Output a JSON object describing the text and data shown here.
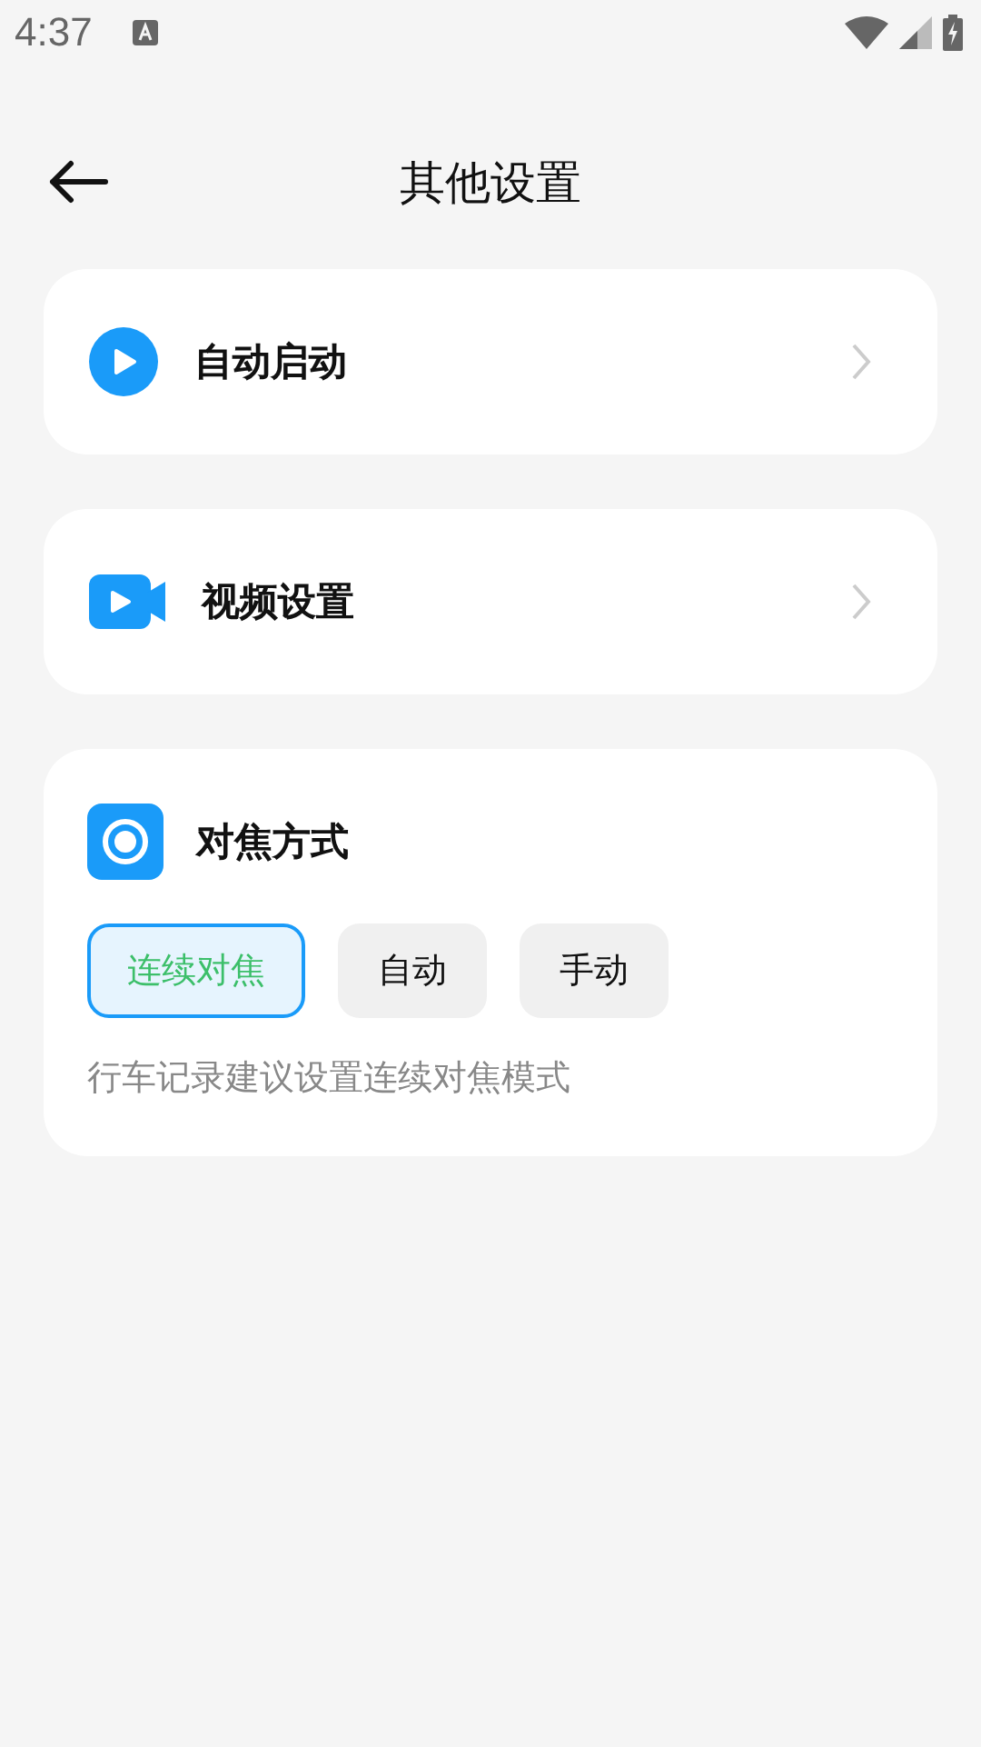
{
  "status_bar": {
    "time": "4:37"
  },
  "header": {
    "title": "其他设置"
  },
  "settings": [
    {
      "label": "自动启动",
      "kind": "play"
    },
    {
      "label": "视频设置",
      "kind": "camera"
    }
  ],
  "focus": {
    "title": "对焦方式",
    "options": [
      {
        "label": "连续对焦",
        "selected": true
      },
      {
        "label": "自动",
        "selected": false
      },
      {
        "label": "手动",
        "selected": false
      }
    ],
    "hint": "行车记录建议设置连续对焦模式"
  }
}
